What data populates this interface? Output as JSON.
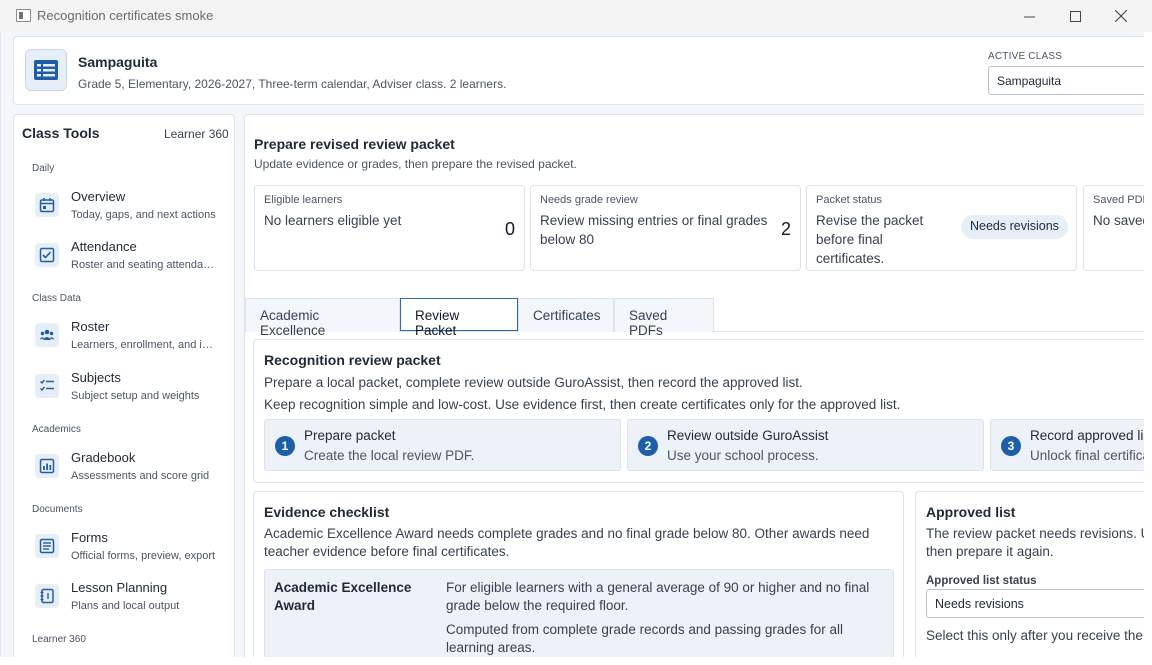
{
  "window": {
    "title": "Recognition certificates smoke"
  },
  "header": {
    "class_name": "Sampaguita",
    "class_desc": "Grade 5, Elementary, 2026-2027, Three-term calendar, Adviser class. 2 learners.",
    "active_class_label": "ACTIVE CLASS",
    "active_class_value": "Sampaguita"
  },
  "sidebar": {
    "title": "Class Tools",
    "learner_link": "Learner 360",
    "sections": {
      "daily": "Daily",
      "class_data": "Class Data",
      "academics": "Academics",
      "documents": "Documents",
      "learner360": "Learner 360"
    },
    "items": [
      {
        "label": "Overview",
        "sub": "Today, gaps, and next actions",
        "icon": "calendar-icon"
      },
      {
        "label": "Attendance",
        "sub": "Roster and seating attendance",
        "icon": "attendance-icon"
      },
      {
        "label": "Roster",
        "sub": "Learners, enrollment, and imports",
        "icon": "people-icon"
      },
      {
        "label": "Subjects",
        "sub": "Subject setup and weights",
        "icon": "list-check-icon"
      },
      {
        "label": "Gradebook",
        "sub": "Assessments and score grid",
        "icon": "chart-icon"
      },
      {
        "label": "Forms",
        "sub": "Official forms, preview, export",
        "icon": "form-icon"
      },
      {
        "label": "Lesson Planning",
        "sub": "Plans and local output",
        "icon": "notebook-icon"
      }
    ]
  },
  "main": {
    "title": "Prepare revised review packet",
    "subtitle": "Update evidence or grades, then prepare the revised packet.",
    "stats": [
      {
        "label": "Eligible learners",
        "text": "No learners eligible yet",
        "value": "0"
      },
      {
        "label": "Needs grade review",
        "text": "Review missing entries or final grades below 80",
        "value": "2"
      },
      {
        "label": "Packet status",
        "text": "Revise the packet before final certificates.",
        "badge": "Needs revisions"
      },
      {
        "label": "Saved PDFs",
        "text": "No saved PDFs"
      }
    ],
    "tabs": [
      "Academic Excellence",
      "Review Packet",
      "Certificates",
      "Saved PDFs"
    ],
    "packet": {
      "title": "Recognition review packet",
      "line1": "Prepare a local packet, complete review outside GuroAssist, then record the approved list.",
      "line2": "Keep recognition simple and low-cost. Use evidence first, then create certificates only for the approved list.",
      "steps": [
        {
          "num": "1",
          "title": "Prepare packet",
          "sub": "Create the local review PDF."
        },
        {
          "num": "2",
          "title": "Review outside GuroAssist",
          "sub": "Use your school process."
        },
        {
          "num": "3",
          "title": "Record approved list",
          "sub": "Unlock final certificates."
        }
      ]
    },
    "evidence": {
      "title": "Evidence checklist",
      "desc": "Academic Excellence Award needs complete grades and no final grade below 80. Other awards need teacher evidence before final certificates.",
      "award_name": "Academic Excellence Award",
      "award_desc1": "For eligible learners with a general average of 90 or higher and no final grade below the required floor.",
      "award_desc2": "Computed from complete grade records and passing grades for all learning areas."
    },
    "approved": {
      "title": "Approved list",
      "desc1": "The review packet needs revisions. Update evidence",
      "desc2": "then prepare it again.",
      "status_label": "Approved list status",
      "status_value": "Needs revisions",
      "hint": "Select this only after you receive the reviewed packet."
    }
  }
}
